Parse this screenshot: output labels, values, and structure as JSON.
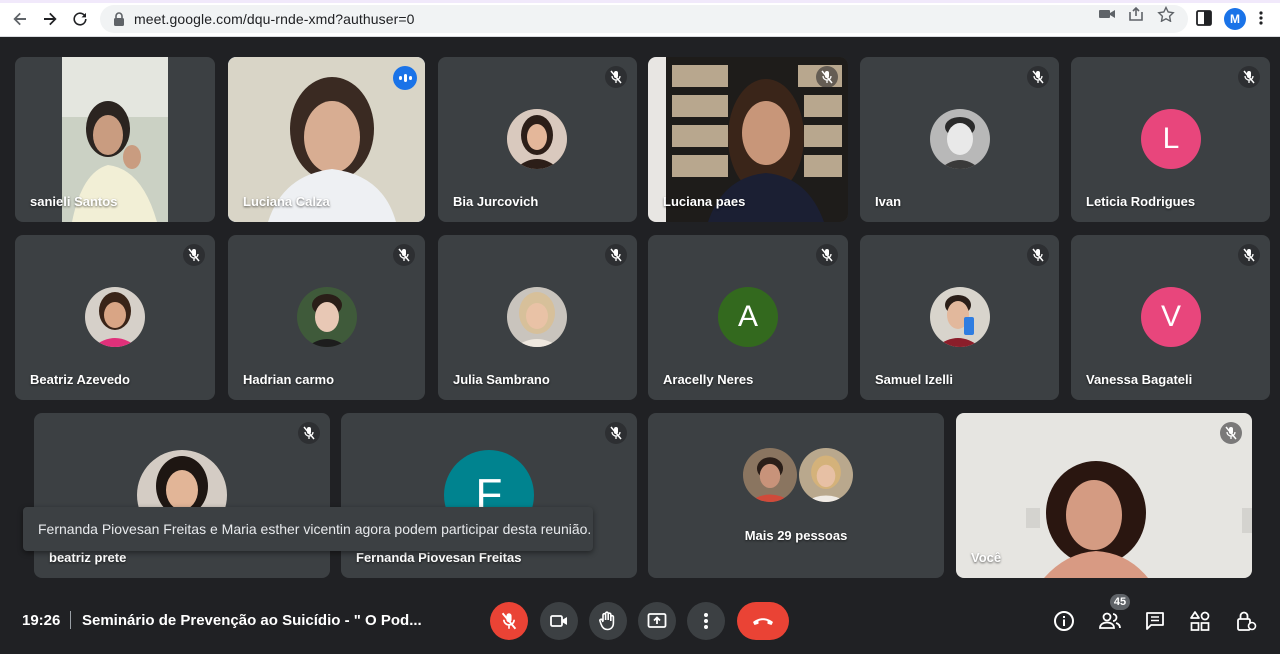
{
  "browser": {
    "url": "meet.google.com/dqu-rnde-xmd?authuser=0",
    "profile_initial": "M"
  },
  "participants": [
    {
      "name": "sanieli Santos",
      "mode": "video",
      "muted": false
    },
    {
      "name": "Luciana Calza",
      "mode": "video",
      "muted": false,
      "speaking": true
    },
    {
      "name": "Bia Jurcovich",
      "mode": "photo",
      "muted": true
    },
    {
      "name": "Luciana paes",
      "mode": "video",
      "muted": true
    },
    {
      "name": "Ivan",
      "mode": "photo",
      "muted": true
    },
    {
      "name": "Leticia Rodrigues",
      "mode": "initial",
      "initial": "L",
      "color": "#e8467c",
      "muted": true
    },
    {
      "name": "Beatriz Azevedo",
      "mode": "photo",
      "muted": true
    },
    {
      "name": "Hadrian carmo",
      "mode": "photo",
      "muted": true
    },
    {
      "name": "Julia Sambrano",
      "mode": "photo",
      "muted": true
    },
    {
      "name": "Aracelly Neres",
      "mode": "initial",
      "initial": "A",
      "color": "#33691e",
      "muted": true
    },
    {
      "name": "Samuel Izelli",
      "mode": "photo",
      "muted": true
    },
    {
      "name": "Vanessa Bagateli",
      "mode": "initial",
      "initial": "V",
      "color": "#e8467c",
      "muted": true
    },
    {
      "name": "beatriz prete",
      "mode": "photo",
      "muted": true
    },
    {
      "name": "Fernanda Piovesan Freitas",
      "mode": "initial",
      "initial": "F",
      "color": "#00838f",
      "muted": true
    },
    {
      "name": "Mais 29 pessoas",
      "mode": "group"
    },
    {
      "name": "Você",
      "mode": "video",
      "muted": true
    }
  ],
  "toast": "Fernanda Piovesan Freitas e Maria esther vicentin agora podem participar desta reunião.",
  "bottom_bar": {
    "time": "19:26",
    "title": "Seminário de Prevenção ao Suicídio - \" O Pod...",
    "participant_count": "45"
  },
  "colors": {
    "background": "#202124",
    "tile": "#3c4043",
    "danger": "#ea4335",
    "accent": "#1a73e8"
  }
}
